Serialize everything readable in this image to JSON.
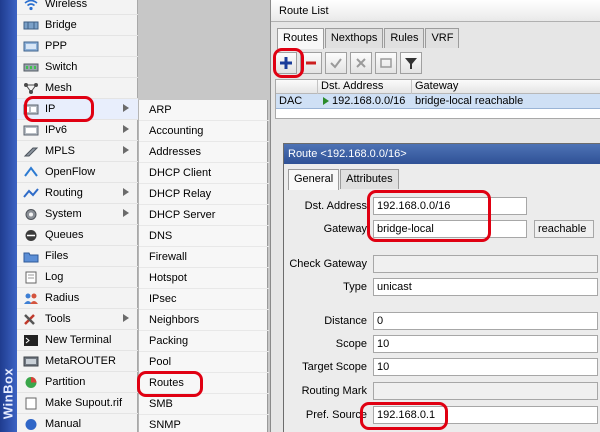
{
  "sidebar": {
    "brand": "WinBox",
    "items": [
      {
        "label": "Wireless",
        "icon": "wireless-icon"
      },
      {
        "label": "Bridge",
        "icon": "bridge-icon"
      },
      {
        "label": "PPP",
        "icon": "ppp-icon"
      },
      {
        "label": "Switch",
        "icon": "switch-icon"
      },
      {
        "label": "Mesh",
        "icon": "mesh-icon"
      },
      {
        "label": "IP",
        "icon": "ip-icon",
        "has_submenu": true
      },
      {
        "label": "IPv6",
        "icon": "ipv6-icon",
        "has_submenu": true
      },
      {
        "label": "MPLS",
        "icon": "mpls-icon",
        "has_submenu": true
      },
      {
        "label": "OpenFlow",
        "icon": "openflow-icon"
      },
      {
        "label": "Routing",
        "icon": "routing-icon",
        "has_submenu": true
      },
      {
        "label": "System",
        "icon": "system-icon",
        "has_submenu": true
      },
      {
        "label": "Queues",
        "icon": "queues-icon"
      },
      {
        "label": "Files",
        "icon": "files-icon"
      },
      {
        "label": "Log",
        "icon": "log-icon"
      },
      {
        "label": "Radius",
        "icon": "radius-icon"
      },
      {
        "label": "Tools",
        "icon": "tools-icon",
        "has_submenu": true
      },
      {
        "label": "New Terminal",
        "icon": "terminal-icon"
      },
      {
        "label": "MetaROUTER",
        "icon": "metarouter-icon"
      },
      {
        "label": "Partition",
        "icon": "partition-icon"
      },
      {
        "label": "Make Supout.rif",
        "icon": "supout-icon"
      },
      {
        "label": "Manual",
        "icon": "manual-icon"
      }
    ]
  },
  "ip_submenu": {
    "items": [
      "ARP",
      "Accounting",
      "Addresses",
      "DHCP Client",
      "DHCP Relay",
      "DHCP Server",
      "DNS",
      "Firewall",
      "Hotspot",
      "IPsec",
      "Neighbors",
      "Packing",
      "Pool",
      "Routes",
      "SMB",
      "SNMP"
    ]
  },
  "route_list": {
    "title": "Route List",
    "tabs": [
      "Routes",
      "Nexthops",
      "Rules",
      "VRF"
    ],
    "columns": [
      "",
      "Dst. Address",
      "Gateway"
    ],
    "rows": [
      {
        "flags": "DAC",
        "dst_address": "192.168.0.0/16",
        "gateway": "bridge-local reachable"
      }
    ]
  },
  "route_dialog": {
    "title": "Route <192.168.0.0/16>",
    "tabs": [
      "General",
      "Attributes"
    ],
    "fields": {
      "dst_address": {
        "label": "Dst. Address",
        "value": "192.168.0.0/16"
      },
      "gateway": {
        "label": "Gateway",
        "value": "bridge-local",
        "status": "reachable"
      },
      "check_gateway": {
        "label": "Check Gateway",
        "value": ""
      },
      "type": {
        "label": "Type",
        "value": "unicast"
      },
      "distance": {
        "label": "Distance",
        "value": "0"
      },
      "scope": {
        "label": "Scope",
        "value": "10"
      },
      "target_scope": {
        "label": "Target Scope",
        "value": "10"
      },
      "routing_mark": {
        "label": "Routing Mark",
        "value": ""
      },
      "pref_source": {
        "label": "Pref. Source",
        "value": "192.168.0.1"
      }
    }
  },
  "colors": {
    "highlight": "#e00012",
    "sidebar_strip": "#2a4fae",
    "dialog_title": "#3a5ea6",
    "selected_row": "#cfe0f5"
  }
}
